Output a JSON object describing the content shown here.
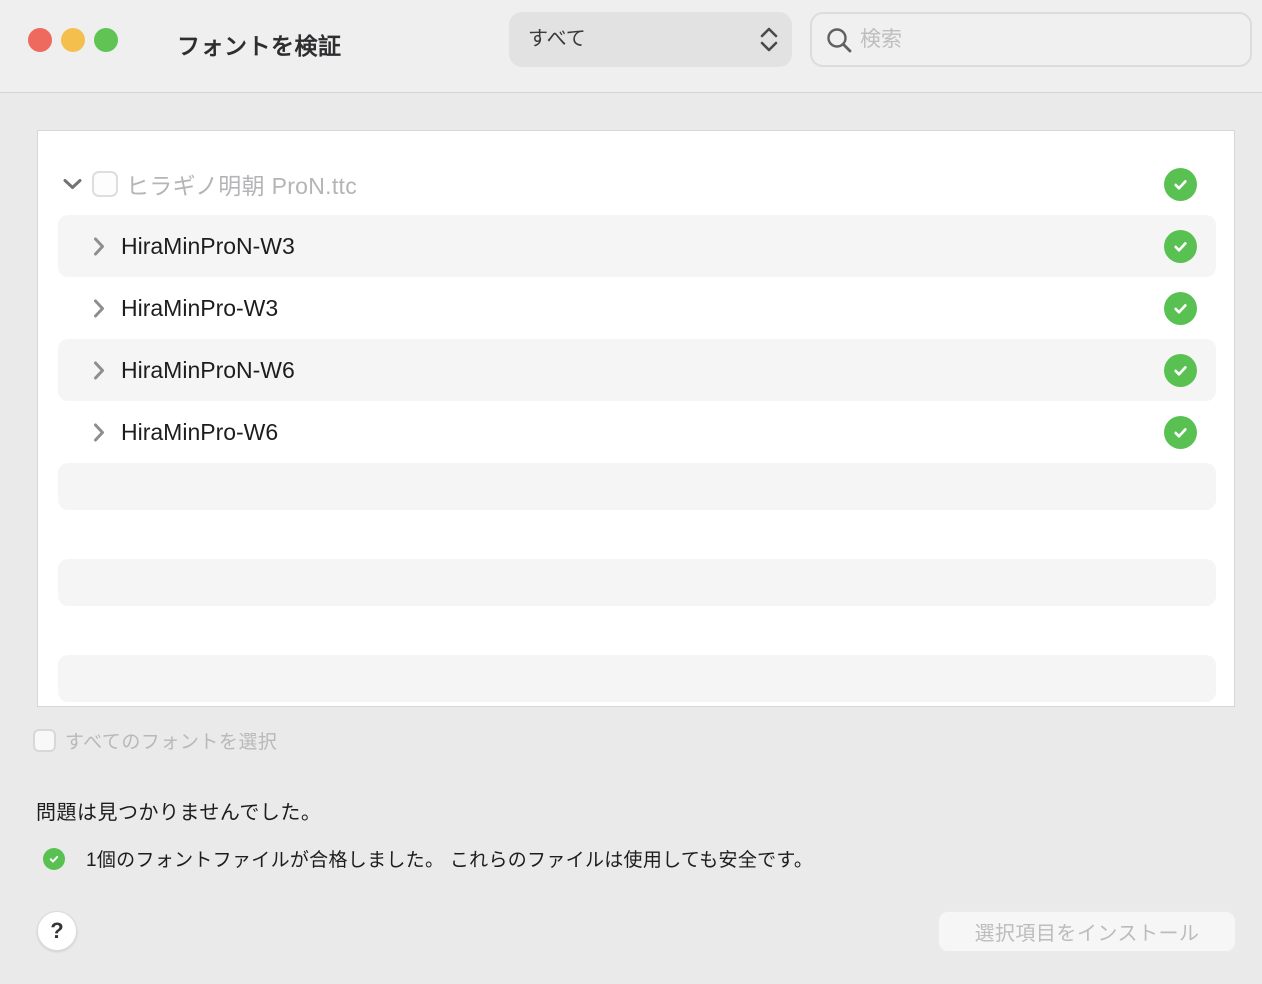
{
  "window": {
    "title": "フォントを検証"
  },
  "toolbar": {
    "filter_value": "すべて",
    "search_placeholder": "検索"
  },
  "list": {
    "group": {
      "label": "ヒラギノ明朝 ProN.ttc",
      "checked": false,
      "status": "passed"
    },
    "fonts": [
      {
        "name": "HiraMinProN-W3",
        "status": "passed"
      },
      {
        "name": "HiraMinPro-W3",
        "status": "passed"
      },
      {
        "name": "HiraMinProN-W6",
        "status": "passed"
      },
      {
        "name": "HiraMinPro-W6",
        "status": "passed"
      }
    ],
    "empty_stripe_rows": 3
  },
  "footer": {
    "select_all_label": "すべてのフォントを選択",
    "select_all_checked": false,
    "result_title": "問題は見つかりませんでした。",
    "result_detail": "1個のフォントファイルが合格しました。 これらのファイルは使用しても安全です。",
    "help_label": "?",
    "install_button_label": "選択項目をインストール",
    "install_button_enabled": false
  },
  "icons": {
    "status": "checkmark-circle",
    "search": "magnifier",
    "filter": "up-down-chevrons",
    "group_disclosure": "chevron-down",
    "font_disclosure": "chevron-right",
    "help": "question-mark"
  },
  "colors": {
    "status_green": "#58c152",
    "traffic_red": "#ee6a5f",
    "traffic_yellow": "#f5bf4e",
    "traffic_green": "#5fc454",
    "titlebar_bg": "#f0efef",
    "content_bg": "#ebeaea",
    "row_stripe": "#f5f5f5",
    "disabled_text": "#b9b8ba"
  }
}
